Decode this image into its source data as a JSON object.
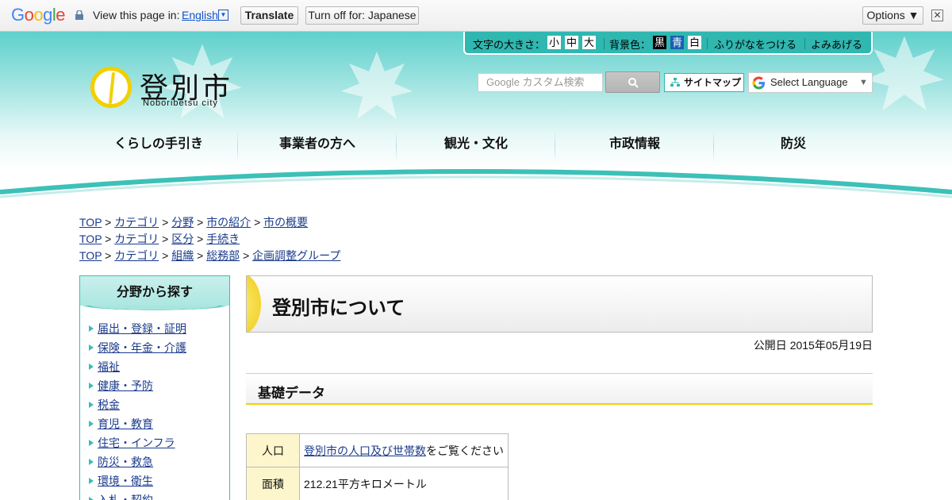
{
  "translate_bar": {
    "logo": "Google",
    "view_label": "View this page in:",
    "language": "English",
    "translate_label": "Translate",
    "turn_off_label": "Turn off for: Japanese",
    "options_label": "Options ▼",
    "close_label": "✕"
  },
  "toolbar": {
    "font_size_label": "文字の大きさ：",
    "sizes": [
      "小",
      "中",
      "大"
    ],
    "bg_label": "背景色：",
    "bg_colors": [
      "黒",
      "青",
      "白"
    ],
    "furigana": "ふりがなをつける",
    "read_aloud": "よみあげる"
  },
  "logo": {
    "name": "登別市",
    "sub": "Noboribetsu city"
  },
  "search": {
    "placeholder": "Google カスタム検索"
  },
  "sitemap_label": "サイトマップ",
  "select_language_label": "Select Language",
  "nav": [
    "くらしの手引き",
    "事業者の方へ",
    "観光・文化",
    "市政情報",
    "防災"
  ],
  "breadcrumbs": [
    [
      "TOP",
      "カテゴリ",
      "分野",
      "市の紹介",
      "市の概要"
    ],
    [
      "TOP",
      "カテゴリ",
      "区分",
      "手続き"
    ],
    [
      "TOP",
      "カテゴリ",
      "組織",
      "総務部",
      "企画調整グループ"
    ]
  ],
  "sidebar": {
    "title": "分野から探す",
    "items": [
      "届出・登録・証明",
      "保険・年金・介護",
      "福祉",
      "健康・予防",
      "税金",
      "育児・教育",
      "住宅・インフラ",
      "防災・救急",
      "環境・衛生",
      "入札・契約"
    ]
  },
  "page": {
    "title": "登別市について",
    "published": "公開日 2015年05月19日",
    "section_title": "基礎データ"
  },
  "table": {
    "rows": [
      {
        "label": "人口",
        "link": "登別市の人口及び世帯数",
        "suffix": "をご覧ください"
      },
      {
        "label": "面積",
        "text": "212.21平方キロメートル"
      }
    ]
  },
  "colors": {
    "accent": "#2fb7b0",
    "highlight": "#f1d000"
  }
}
